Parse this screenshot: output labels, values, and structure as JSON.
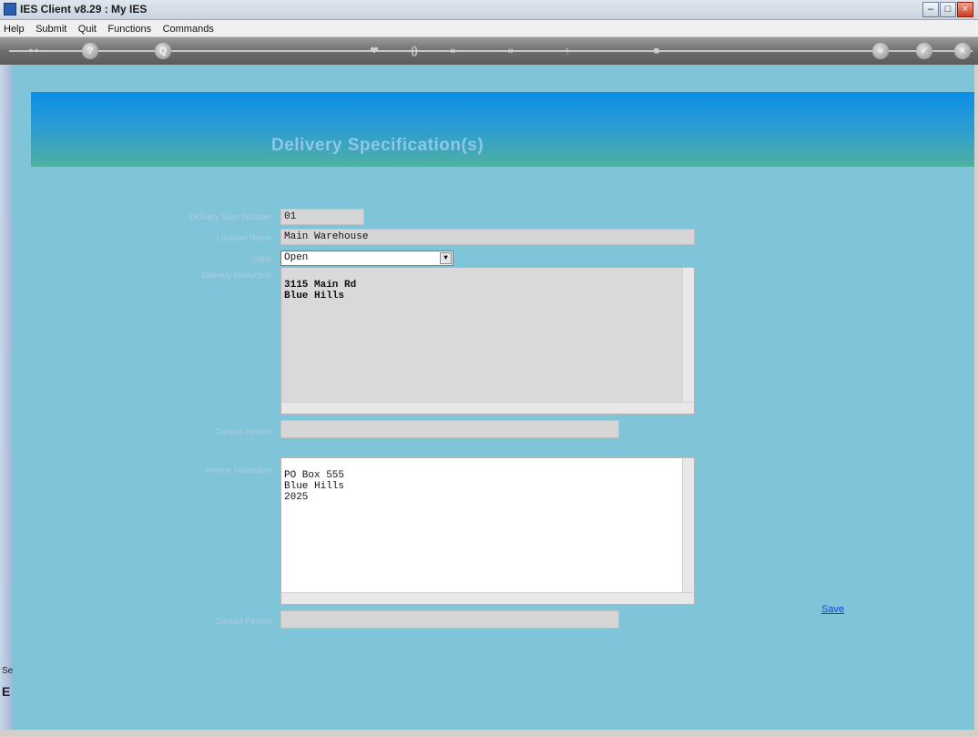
{
  "window": {
    "title": "IES Client v8.29 : My IES"
  },
  "menu": [
    "Help",
    "Submit",
    "Quit",
    "Functions",
    "Commands"
  ],
  "toolbar": {
    "buttons": [
      "?",
      "Q",
      "❤",
      "()",
      "«",
      "»",
      "↑",
      "■",
      "«",
      "✓",
      "×"
    ]
  },
  "left_strip": {
    "tab1": "Ser",
    "tab2": "E"
  },
  "page": {
    "title": "Delivery Specification(s)"
  },
  "form": {
    "delivery_spec_number": {
      "label": "Delivery Spec Number",
      "value": "01"
    },
    "location_name": {
      "label": "Location Name",
      "value": "Main Warehouse"
    },
    "state": {
      "label": "State",
      "value": "Open"
    },
    "delivery_instruction": {
      "label": "Delivery Instruction",
      "value": "3115 Main Rd\nBlue Hills"
    },
    "contact_person_1": {
      "label": "Contact Person",
      "value": ""
    },
    "invoice_instruction": {
      "label": "Invoice Instruction",
      "value": "PO Box 555\nBlue Hills\n2025"
    },
    "contact_person_2": {
      "label": "Contact Person",
      "value": ""
    }
  },
  "actions": {
    "save": "Save"
  }
}
